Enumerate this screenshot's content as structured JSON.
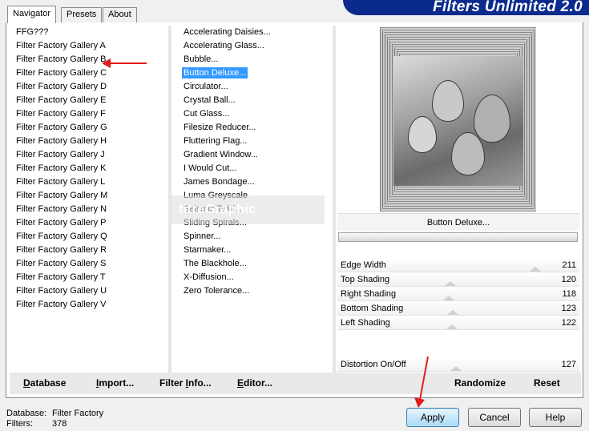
{
  "banner": {
    "title": "Filters Unlimited 2.0"
  },
  "tabs": [
    {
      "label": "Navigator",
      "active": true
    },
    {
      "label": "Presets",
      "active": false
    },
    {
      "label": "About",
      "active": false
    }
  ],
  "categories": [
    "FFG???",
    "Filter Factory Gallery A",
    "Filter Factory Gallery B",
    "Filter Factory Gallery C",
    "Filter Factory Gallery D",
    "Filter Factory Gallery E",
    "Filter Factory Gallery F",
    "Filter Factory Gallery G",
    "Filter Factory Gallery H",
    "Filter Factory Gallery J",
    "Filter Factory Gallery K",
    "Filter Factory Gallery L",
    "Filter Factory Gallery M",
    "Filter Factory Gallery N",
    "Filter Factory Gallery P",
    "Filter Factory Gallery Q",
    "Filter Factory Gallery R",
    "Filter Factory Gallery S",
    "Filter Factory Gallery T",
    "Filter Factory Gallery U",
    "Filter Factory Gallery V"
  ],
  "filters": [
    "Accelerating Daisies...",
    "Accelerating Glass...",
    "Bubble...",
    "Button Deluxe...",
    "Circulator...",
    "Crystal Ball...",
    "Cut Glass...",
    "Filesize Reducer...",
    "Fluttering Flag...",
    "Gradient Window...",
    "I Would Cut...",
    "James Bondage...",
    "Luma Greyscale",
    "Seismic Twirl...",
    "Sliding Spirals...",
    "Spinner...",
    "Starmaker...",
    "The Blackhole...",
    "X-Diffusion...",
    "Zero Tolerance..."
  ],
  "selected_filter_index": 3,
  "watermark": "titreGraphic",
  "preview": {
    "filter_name": "Button Deluxe..."
  },
  "sliders": [
    {
      "label": "Edge Width",
      "value": "211"
    },
    {
      "label": "Top Shading",
      "value": "120"
    },
    {
      "label": "Right Shading",
      "value": "118"
    },
    {
      "label": "Bottom Shading",
      "value": "123"
    },
    {
      "label": "Left Shading",
      "value": "122"
    }
  ],
  "distortion": {
    "label": "Distortion On/Off",
    "value": "127"
  },
  "toolbar": {
    "database": {
      "ul": "D",
      "rest": "atabase"
    },
    "import": {
      "ul": "I",
      "rest": "mport..."
    },
    "filter_info": {
      "pre": "Filter ",
      "ul": "I",
      "rest": "nfo..."
    },
    "editor": {
      "ul": "E",
      "rest": "ditor..."
    },
    "randomize": "Randomize",
    "reset": "Reset"
  },
  "status": {
    "database_label": "Database:",
    "database_value": "Filter Factory",
    "filters_label": "Filters:",
    "filters_value": "378"
  },
  "buttons": {
    "apply": "Apply",
    "cancel": "Cancel",
    "help": "Help"
  },
  "colors": {
    "banner": "#0a2a8e",
    "selection": "#3399ff",
    "annotation_arrow": "#e11b1b"
  }
}
